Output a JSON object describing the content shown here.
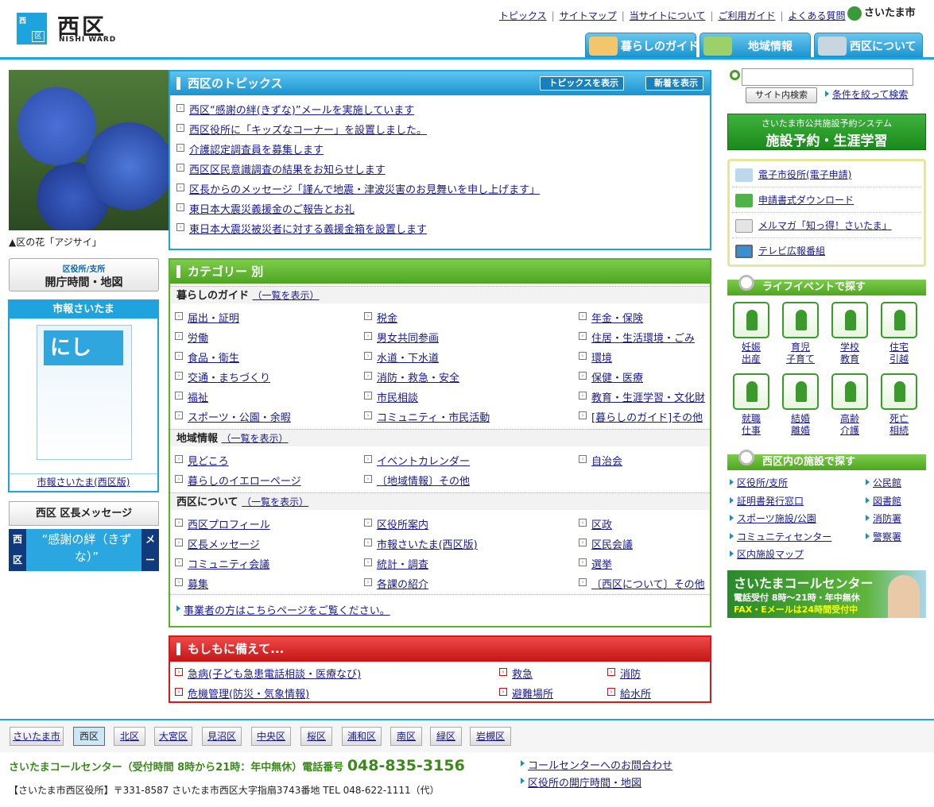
{
  "header": {
    "logo_mark_top": "西",
    "logo_mark_bottom": "区",
    "title": "西区",
    "subtitle": "NISHI WARD",
    "city": "さいたま市",
    "links": [
      "トピックス",
      "サイトマップ",
      "当サイトについて",
      "ご利用ガイド",
      "よくある質問"
    ],
    "tabs": [
      "暮らしのガイド",
      "地域情報",
      "西区について"
    ]
  },
  "left": {
    "flower_caption": "▲区の花「アジサイ」",
    "office_sub": "区役所/支所",
    "office_main": "開庁時間・地図",
    "shiho_title": "市報さいたま",
    "shiho_cover": "にし",
    "shiho_link": "市報さいたま(西区版)",
    "message_title": "西区 区長メッセージ",
    "message_left": "西区",
    "message_right": "メール",
    "message_banner": "“感謝の絆（きずな）”"
  },
  "topics": {
    "title": "西区のトピックス",
    "btn_show": "トピックスを表示",
    "btn_new": "新着を表示",
    "items": [
      "西区“感謝の絆(きずな)”メールを実施しています",
      "西区役所に「キッズなコーナー」を設置しました。",
      "介護認定調査員を募集します",
      "西区区民意識調査の結果をお知らせします",
      "区長からのメッセージ「謹んで地震・津波災害のお見舞いを申し上げます」",
      "東日本大震災義援金のご報告とお礼",
      "東日本大震災被災者に対する義援金箱を設置します"
    ]
  },
  "category": {
    "title": "カテゴリー 別",
    "list_all": "（一覧を表示）",
    "guide_title": "暮らしのガイド",
    "guide": [
      "届出・証明",
      "税金",
      "年金・保険",
      "労働",
      "男女共同参画",
      "住居・生活環境・ごみ",
      "食品・衛生",
      "水道・下水道",
      "環境",
      "交通・まちづくり",
      "消防・救急・安全",
      "保健・医療",
      "福祉",
      "市民相談",
      "教育・生涯学習・文化財",
      "スポーツ・公園・余暇",
      "コミュニティ・市民活動",
      "[暮らしのガイド]その他"
    ],
    "area_title": "地域情報",
    "area": [
      "見どころ",
      "イベントカレンダー",
      "自治会",
      "暮らしのイエローページ",
      "〔地域情報〕その他"
    ],
    "about_title": "西区について",
    "about": [
      "西区プロフィール",
      "区役所案内",
      "区政",
      "区長メッセージ",
      "市報さいたま(西区版)",
      "区民会議",
      "コミュニティ会議",
      "統計・調査",
      "選挙",
      "募集",
      "各課の紹介",
      "〔西区について〕その他"
    ],
    "business": "事業者の方はこちらページをご覧ください。"
  },
  "emergency": {
    "title": "もしもに備えて...",
    "items": [
      "急病(子ども急患電話相談・医療なび)",
      "救急",
      "消防",
      "危機管理(防災・気象情報)",
      "避難場所",
      "給水所"
    ]
  },
  "right": {
    "search_placeholder": "",
    "search_btn": "サイト内検索",
    "search_adv": "条件を絞って検索",
    "reserve_sub": "さいたま市公共施設予約システム",
    "reserve_main": "施設予約・生涯学習",
    "services": [
      "電子市役所(電子申請)",
      "申請書式ダウンロード",
      "メルマガ「知っ得！さいたま」",
      "テレビ広報番組"
    ],
    "life_title": "ライフイベントで探す",
    "life": [
      [
        "妊娠",
        "出産"
      ],
      [
        "育児",
        "子育て"
      ],
      [
        "学校",
        "教育"
      ],
      [
        "住宅",
        "引越"
      ],
      [
        "就職",
        "仕事"
      ],
      [
        "結婚",
        "離婚"
      ],
      [
        "高齢",
        "介護"
      ],
      [
        "死亡",
        "相続"
      ]
    ],
    "facility_title": "西区内の施設で探す",
    "facilities": [
      "区役所/支所",
      "公民館",
      "証明書発行窓口",
      "図書館",
      "スポーツ施設/公園",
      "消防署",
      "コミュニティセンター",
      "警察署",
      "区内施設マップ"
    ],
    "cc_title": "さいたまコールセンター",
    "cc_hours": "電話受付 8時〜21時・年中無休",
    "cc_fax": "FAX・Eメールは24時間受付中"
  },
  "footer": {
    "wards": [
      "さいたま市",
      "西区",
      "北区",
      "大宮区",
      "見沼区",
      "中央区",
      "桜区",
      "浦和区",
      "南区",
      "緑区",
      "岩槻区"
    ],
    "cc_text": "さいたまコールセンター（受付時間 8時から21時：年中無休）電話番号",
    "cc_num": "048-835-3156",
    "address": "【さいたま市西区役所】〒331-8587 さいたま市西区大字指扇3743番地 TEL 048-622-1111（代）",
    "link1": "コールセンターへのお問合わせ",
    "link2": "区役所の開庁時間・地図"
  },
  "colors": {
    "accent": "#1fa3dc",
    "green": "#5ab229",
    "red": "#d21c1c"
  }
}
